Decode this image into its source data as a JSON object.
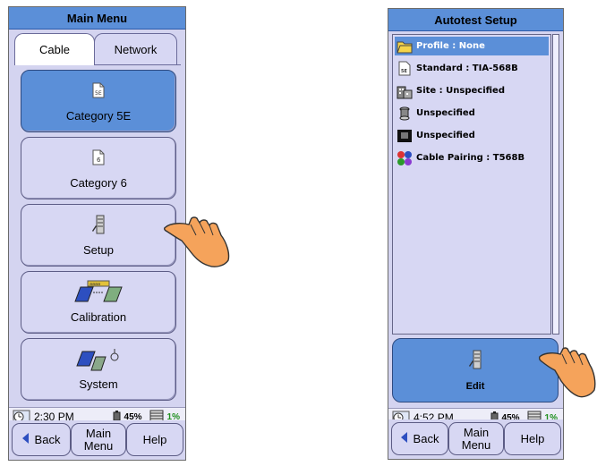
{
  "left_screen": {
    "title": "Main Menu",
    "tabs": [
      {
        "label": "Cable"
      },
      {
        "label": "Network"
      }
    ],
    "buttons": [
      {
        "label": "Category 5E",
        "icon": "document-5e-icon",
        "badge": "5E"
      },
      {
        "label": "Category 6",
        "icon": "document-6-icon",
        "badge": "6"
      },
      {
        "label": "Setup",
        "icon": "setup-icon"
      },
      {
        "label": "Calibration",
        "icon": "calibration-icon",
        "badge": "aaaa"
      },
      {
        "label": "System",
        "icon": "system-icon"
      }
    ],
    "status": {
      "time": "2:30 PM",
      "battery": "45%",
      "memory": "1%"
    },
    "softkeys": {
      "back": "Back",
      "main_menu": "Main Menu",
      "help": "Help"
    }
  },
  "right_screen": {
    "title": "Autotest Setup",
    "items": [
      {
        "label": "Profile : None",
        "icon": "folder-icon",
        "selected": true
      },
      {
        "label": "Standard : TIA-568B",
        "icon": "document-5e-icon",
        "badge": "5E"
      },
      {
        "label": "Site : Unspecified",
        "icon": "building-icon"
      },
      {
        "label": "Unspecified",
        "icon": "cable-spool-icon"
      },
      {
        "label": "Unspecified",
        "icon": "rj45-jack-icon"
      },
      {
        "label": "Cable Pairing : T568B",
        "icon": "pairing-dots-icon"
      }
    ],
    "edit_button": {
      "label": "Edit",
      "icon": "setup-icon"
    },
    "status": {
      "time": "4:52 PM",
      "battery": "45%",
      "memory": "1%"
    },
    "softkeys": {
      "back": "Back",
      "main_menu": "Main Menu",
      "help": "Help"
    }
  },
  "colors": {
    "selected": "#5b8fd8",
    "panel": "#d7d7f3",
    "hand": "#f5a35b"
  }
}
